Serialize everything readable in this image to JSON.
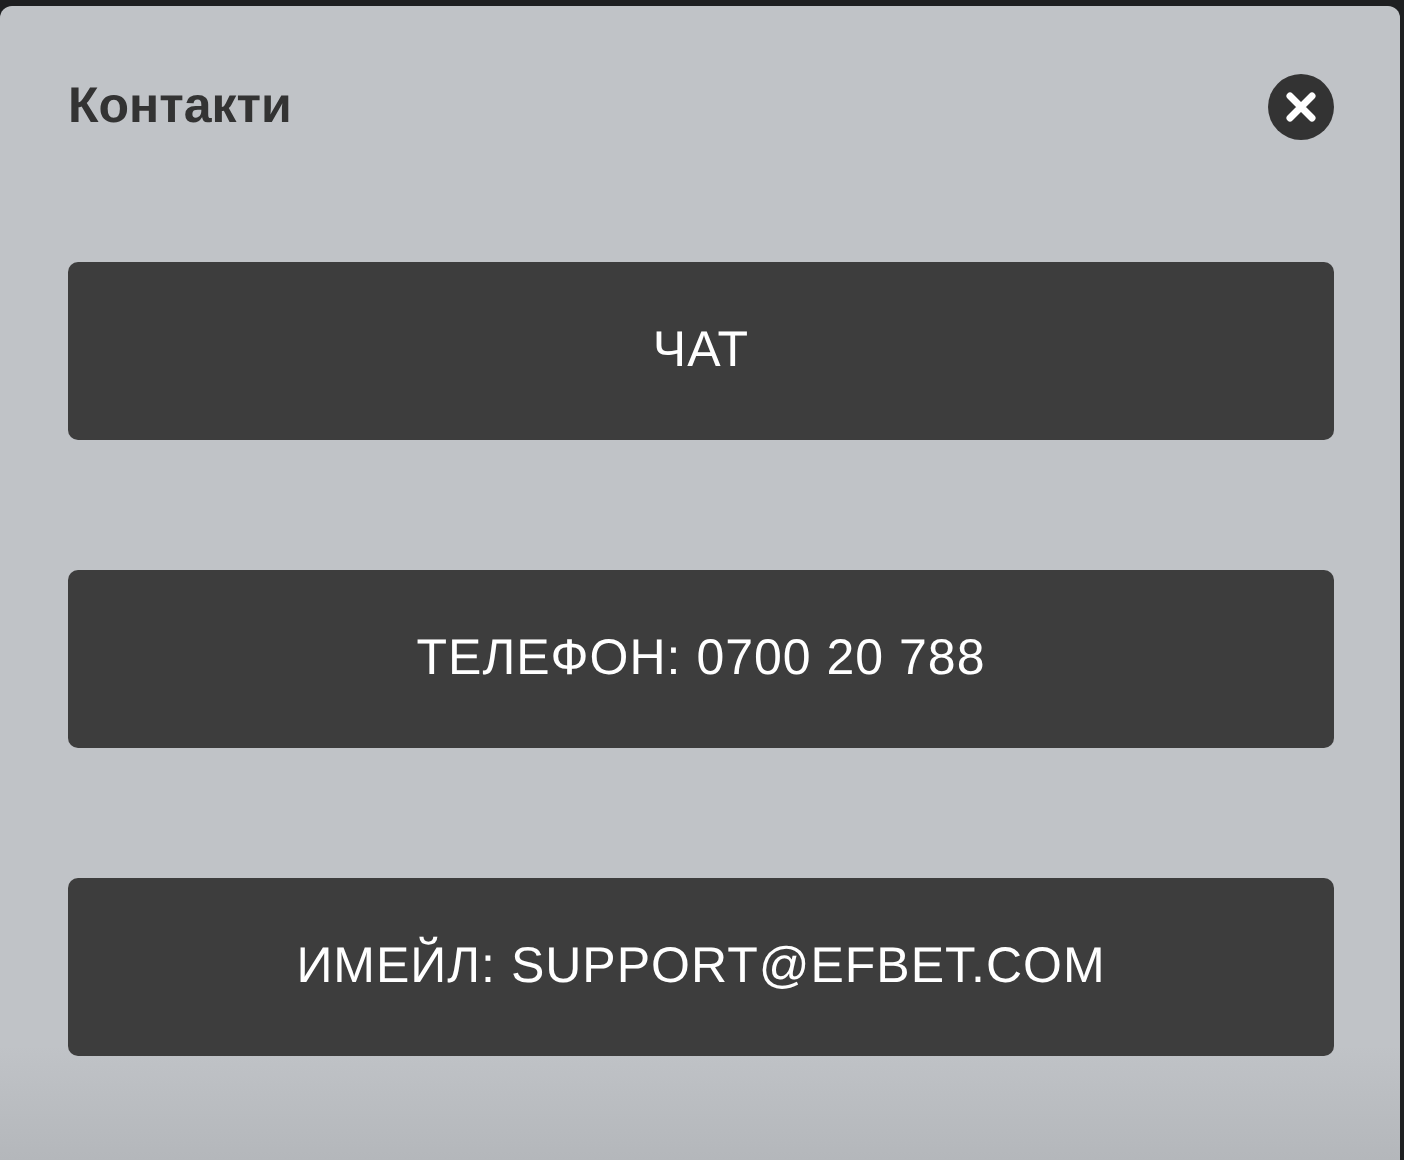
{
  "dialog": {
    "title": "Контакти"
  },
  "buttons": [
    {
      "label": "ЧАТ"
    },
    {
      "label": "ТЕЛЕФОН: 0700 20 788"
    },
    {
      "label": "ИМЕЙЛ: SUPPORT@EFBET.COM"
    }
  ]
}
